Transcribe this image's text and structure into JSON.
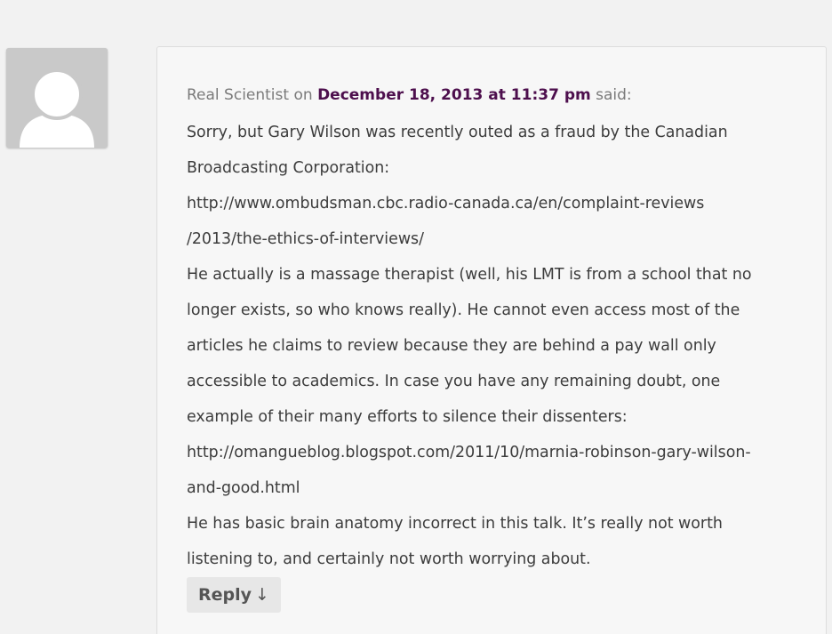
{
  "comment": {
    "author": "Real Scientist",
    "on_word": "on",
    "date_link": "December 18, 2013 at 11:37 pm",
    "said_word": "said:",
    "lines": [
      "Sorry, but Gary Wilson was recently outed as a fraud by the Canadian",
      "Broadcasting Corporation:",
      "http://www.ombudsman.cbc.radio-canada.ca/en/complaint-reviews",
      "/2013/the-ethics-of-interviews/",
      "He actually is a massage therapist (well, his LMT is from a school that no",
      "longer exists, so who knows really). He cannot even access most of the",
      "articles he claims to review because they are behind a pay wall only",
      "accessible to academics. In case you have any remaining doubt, one",
      "example of their many efforts to silence their dissenters:",
      "http://omangueblog.blogspot.com/2011/10/marnia-robinson-gary-wilson-",
      "and-good.html",
      "He has basic brain anatomy incorrect in this talk. It’s really not worth",
      "listening to, and certainly not worth worrying about."
    ],
    "reply_label": "Reply",
    "reply_arrow": "↓"
  },
  "avatar": {
    "icon": "default-user-avatar-icon",
    "bg_color": "#c9c9c9"
  },
  "colors": {
    "date_link": "#4d0f4d",
    "page_bg": "#f2f2f2",
    "box_bg": "#f7f7f7"
  }
}
